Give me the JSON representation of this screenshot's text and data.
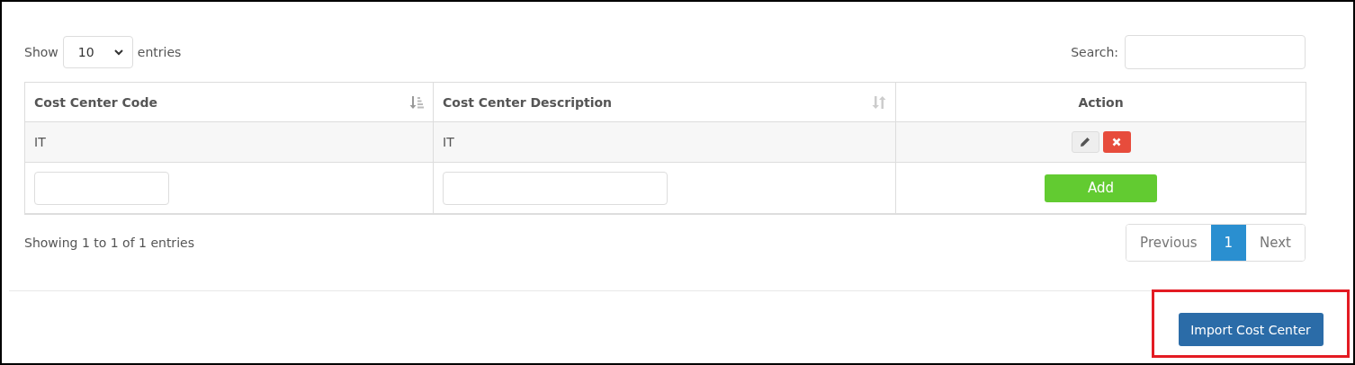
{
  "length_control": {
    "label_before": "Show",
    "value": "10",
    "label_after": "entries"
  },
  "search": {
    "label": "Search:"
  },
  "table": {
    "columns": [
      {
        "label": "Cost Center Code",
        "kind": "sorted_descending"
      },
      {
        "label": "Cost Center Description",
        "kind": "sortable"
      },
      {
        "label": "Action",
        "kind": "plain"
      }
    ],
    "rows": [
      {
        "code": "IT",
        "description": "IT"
      }
    ],
    "add_button": "Add"
  },
  "info": "Showing 1 to 1 of 1 entries",
  "pagination": [
    {
      "label": "Previous",
      "selected": false
    },
    {
      "label": "1",
      "selected": true
    },
    {
      "label": "Next",
      "selected": false
    }
  ],
  "import_button": {
    "label": "Import Cost Center",
    "highlighted": true
  }
}
